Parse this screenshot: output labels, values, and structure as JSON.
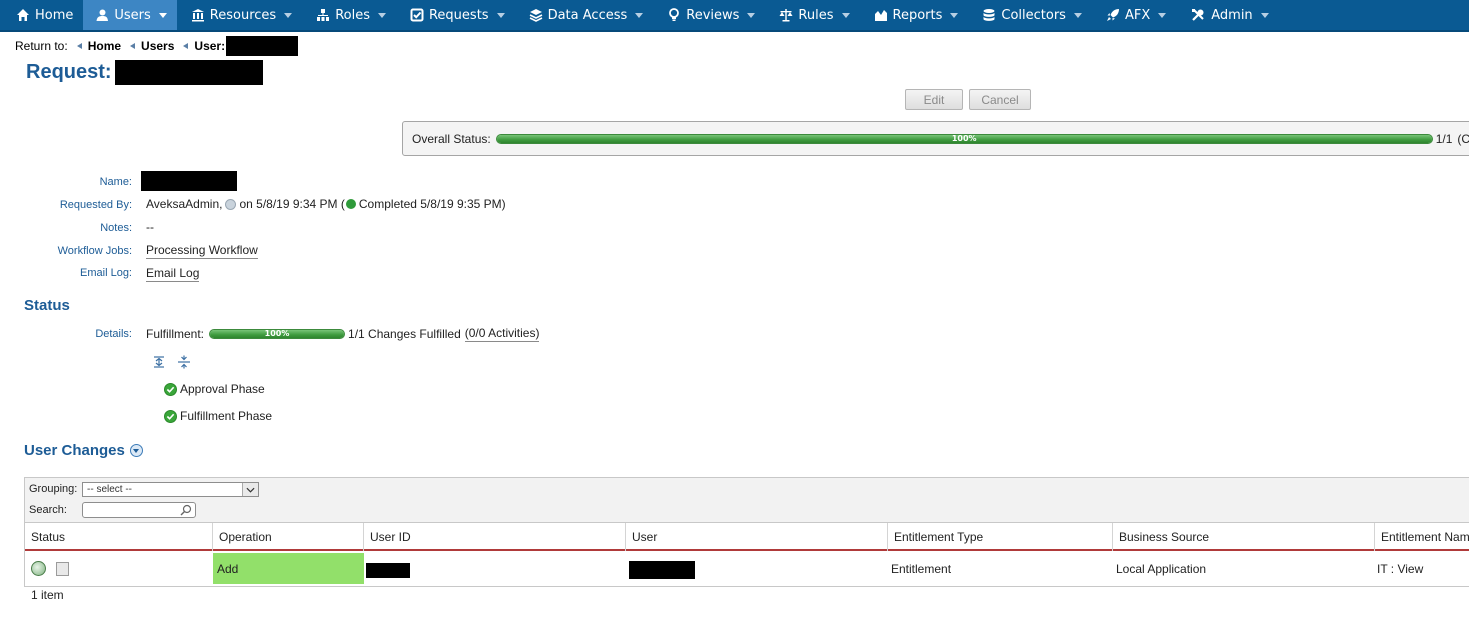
{
  "nav": {
    "items": [
      {
        "label": "Home",
        "icon": "home-icon"
      },
      {
        "label": "Users",
        "icon": "user-icon"
      },
      {
        "label": "Resources",
        "icon": "bank-icon"
      },
      {
        "label": "Roles",
        "icon": "hierarchy-icon"
      },
      {
        "label": "Requests",
        "icon": "checkbox-icon"
      },
      {
        "label": "Data Access",
        "icon": "layers-icon"
      },
      {
        "label": "Reviews",
        "icon": "bulb-icon"
      },
      {
        "label": "Rules",
        "icon": "scale-icon"
      },
      {
        "label": "Reports",
        "icon": "chart-icon"
      },
      {
        "label": "Collectors",
        "icon": "database-icon"
      },
      {
        "label": "AFX",
        "icon": "rocket-icon"
      },
      {
        "label": "Admin",
        "icon": "tools-icon"
      }
    ],
    "active": "Users",
    "colors": {
      "bar": "#0a5a93",
      "active": "#3d86c4"
    }
  },
  "breadcrumb": {
    "prefix": "Return to:",
    "items": [
      "Home",
      "Users",
      "User:"
    ]
  },
  "page": {
    "title": "Request:"
  },
  "actions": {
    "edit": "Edit",
    "cancel": "Cancel"
  },
  "overall_status": {
    "label": "Overall Status:",
    "percent_text": "100%",
    "progress": 1.0,
    "count": "1/1",
    "trailing": "(C"
  },
  "details": {
    "name_label": "Name:",
    "requested_by_label": "Requested By:",
    "requested_by_user": "AveksaAdmin,",
    "requested_on": "on 5/8/19 9:34 PM (",
    "completed": "Completed 5/8/19 9:35 PM)",
    "notes_label": "Notes:",
    "notes_value": "--",
    "workflow_label": "Workflow Jobs:",
    "workflow_value": "Processing Workflow",
    "email_label": "Email Log:",
    "email_value": "Email Log"
  },
  "status": {
    "title": "Status",
    "details_label": "Details:",
    "fulfillment_label": "Fulfillment:",
    "fulfillment_percent_text": "100%",
    "fulfillment_progress": 1.0,
    "fulfillment_summary": "1/1 Changes Fulfilled",
    "activities": "(0/0 Activities)",
    "phases": [
      "Approval Phase",
      "Fulfillment Phase"
    ]
  },
  "user_changes": {
    "title": "User Changes",
    "grouping_label": "Grouping:",
    "grouping_value": "-- select --",
    "search_label": "Search:",
    "columns": [
      "Status",
      "Operation",
      "User ID",
      "User",
      "Entitlement Type",
      "Business Source",
      "Entitlement Nam"
    ],
    "rows": [
      {
        "operation": "Add",
        "entitlement_type": "Entitlement",
        "business_source": "Local Application",
        "entitlement_name": "IT : View"
      }
    ],
    "count": "1 item",
    "colors": {
      "add_cell": "#92e06a",
      "header_rule": "#b03a3a"
    }
  }
}
